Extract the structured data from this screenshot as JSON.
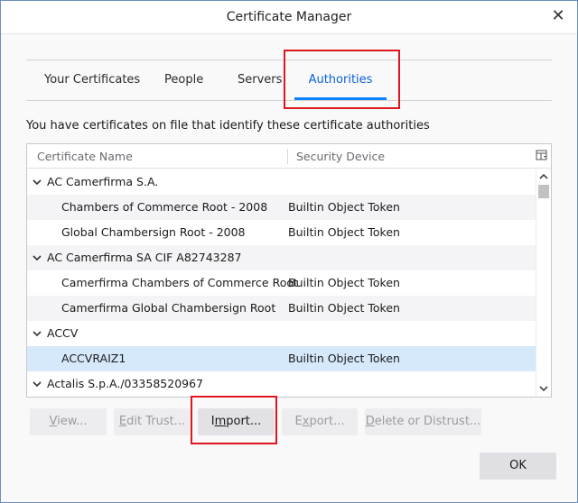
{
  "window": {
    "title": "Certificate Manager",
    "close_glyph": "✕"
  },
  "tabs": [
    {
      "label": "Your Certificates",
      "selected": false
    },
    {
      "label": "People",
      "selected": false
    },
    {
      "label": "Servers",
      "selected": false
    },
    {
      "label": "Authorities",
      "selected": true
    }
  ],
  "description": "You have certificates on file that identify these certificate authorities",
  "tree": {
    "columns": {
      "name": "Certificate Name",
      "device": "Security Device"
    },
    "rows": [
      {
        "type": "group",
        "name": "AC Camerfirma S.A.",
        "device": ""
      },
      {
        "type": "item",
        "name": "Chambers of Commerce Root - 2008",
        "device": "Builtin Object Token"
      },
      {
        "type": "item",
        "name": "Global Chambersign Root - 2008",
        "device": "Builtin Object Token"
      },
      {
        "type": "group",
        "name": "AC Camerfirma SA CIF A82743287",
        "device": ""
      },
      {
        "type": "item",
        "name": "Camerfirma Chambers of Commerce Root",
        "device": "Builtin Object Token"
      },
      {
        "type": "item",
        "name": "Camerfirma Global Chambersign Root",
        "device": "Builtin Object Token"
      },
      {
        "type": "group",
        "name": "ACCV",
        "device": ""
      },
      {
        "type": "item",
        "name": "ACCVRAIZ1",
        "device": "Builtin Object Token",
        "selected": true
      },
      {
        "type": "group",
        "name": "Actalis S.p.A./03358520967",
        "device": ""
      }
    ]
  },
  "buttons": {
    "view": {
      "accel": "V",
      "rest": "iew..."
    },
    "edit_trust": {
      "accel": "E",
      "rest": "dit Trust..."
    },
    "import": {
      "pre": "I",
      "accel": "m",
      "rest": "port..."
    },
    "export": {
      "pre": "E",
      "accel": "x",
      "rest": "port..."
    },
    "delete": {
      "accel": "D",
      "rest": "elete or Distrust..."
    },
    "ok": "OK"
  },
  "colors": {
    "accent": "#0a84ff",
    "highlight": "#e0161f",
    "selected_row": "#d6e9fb"
  }
}
